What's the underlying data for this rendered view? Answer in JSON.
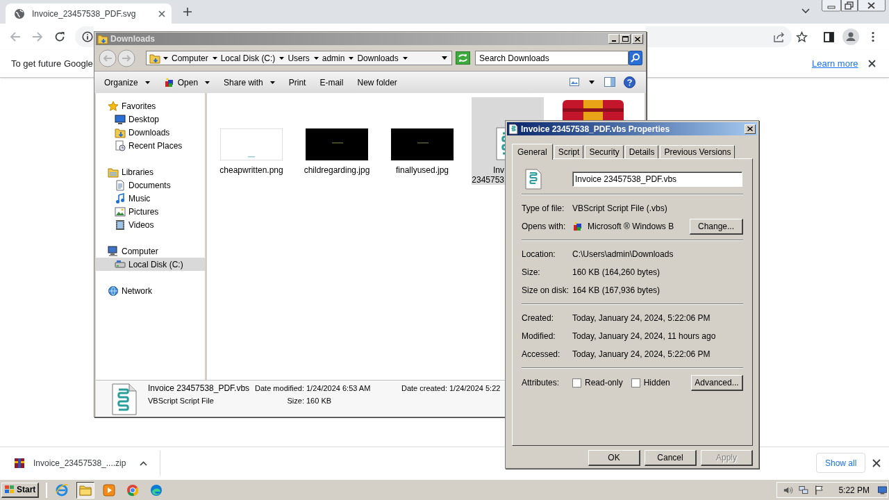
{
  "browser": {
    "tab": {
      "title": "Invoice_23457538_PDF.svg"
    },
    "infobar": {
      "message": "To get future Google",
      "link": "Learn more"
    },
    "download_shelf": {
      "filename": "Invoice_23457538_....zip",
      "show_all": "Show all"
    }
  },
  "explorer": {
    "title": "Downloads",
    "breadcrumb": [
      "Computer",
      "Local Disk (C:)",
      "Users",
      "admin",
      "Downloads"
    ],
    "search": {
      "placeholder": "Search Downloads"
    },
    "toolbar": [
      {
        "label": "Organize",
        "kind": "menu"
      },
      {
        "label": "Open",
        "kind": "app-menu"
      },
      {
        "label": "Share with",
        "kind": "menu"
      },
      {
        "label": "Print",
        "kind": "plain"
      },
      {
        "label": "E-mail",
        "kind": "plain"
      },
      {
        "label": "New folder",
        "kind": "plain"
      }
    ],
    "nav": [
      {
        "label": "Favorites",
        "kind": "star",
        "selected": false,
        "children": [
          {
            "label": "Desktop",
            "kind": "desktop",
            "selected": false
          },
          {
            "label": "Downloads",
            "kind": "downloads",
            "selected": false
          },
          {
            "label": "Recent Places",
            "kind": "recent",
            "selected": false
          }
        ]
      },
      {
        "label": "Libraries",
        "kind": "library",
        "selected": false,
        "children": [
          {
            "label": "Documents",
            "kind": "documents",
            "selected": false
          },
          {
            "label": "Music",
            "kind": "music",
            "selected": false
          },
          {
            "label": "Pictures",
            "kind": "pictures",
            "selected": false
          },
          {
            "label": "Videos",
            "kind": "videos",
            "selected": false
          }
        ]
      },
      {
        "label": "Computer",
        "kind": "computer",
        "selected": false,
        "children": [
          {
            "label": "Local Disk (C:)",
            "kind": "disk",
            "selected": true
          }
        ]
      },
      {
        "label": "Network",
        "kind": "network",
        "selected": false
      }
    ],
    "files": [
      {
        "kind": "thumb-light",
        "lines": [
          "cheapwritten.png"
        ],
        "selected": false
      },
      {
        "kind": "thumb-dark",
        "lines": [
          "childregarding.jpg"
        ],
        "selected": false
      },
      {
        "kind": "thumb-dark",
        "lines": [
          "finallyused.jpg"
        ],
        "selected": false
      },
      {
        "kind": "script",
        "lines": [
          "Inv",
          "2345753"
        ],
        "selected": true
      },
      {
        "kind": "archive",
        "selected": false
      }
    ],
    "details": {
      "name": "Invoice 23457538_PDF.vbs",
      "type": "VBScript Script File",
      "fields": [
        {
          "label": "Date modified:",
          "value": "1/24/2024 6:53 AM"
        },
        {
          "label": "Date created:",
          "value": "1/24/2024 5:22"
        },
        {
          "label": "Size:",
          "value": "160 KB"
        }
      ]
    }
  },
  "properties": {
    "title": "Invoice 23457538_PDF.vbs Properties",
    "tabs": [
      {
        "label": "General",
        "selected": true
      },
      {
        "label": "Script",
        "selected": false
      },
      {
        "label": "Security",
        "selected": false
      },
      {
        "label": "Details",
        "selected": false
      },
      {
        "label": "Previous Versions",
        "selected": false
      }
    ],
    "filename": "Invoice 23457538_PDF.vbs",
    "sections": [
      [
        {
          "kind": "text",
          "label": "Type of file:",
          "value": "VBScript Script File (.vbs)"
        },
        {
          "kind": "app",
          "label": "Opens with:",
          "value": "Microsoft ® Windows B",
          "button": "Change..."
        }
      ],
      [
        {
          "kind": "text",
          "label": "Location:",
          "value": "C:\\Users\\admin\\Downloads"
        },
        {
          "kind": "text",
          "label": "Size:",
          "value": "160 KB (164,260 bytes)"
        },
        {
          "kind": "text",
          "label": "Size on disk:",
          "value": "164 KB (167,936 bytes)"
        }
      ],
      [
        {
          "kind": "text",
          "label": "Created:",
          "value": "Today, January 24, 2024, 5:22:06 PM"
        },
        {
          "kind": "text",
          "label": "Modified:",
          "value": "Today, January 24, 2024, 11 hours ago"
        },
        {
          "kind": "text",
          "label": "Accessed:",
          "value": "Today, January 24, 2024, 5:22:06 PM"
        }
      ]
    ],
    "attributes": {
      "label": "Attributes:",
      "options": [
        {
          "label": "Read-only",
          "checked": false
        },
        {
          "label": "Hidden",
          "checked": false
        }
      ],
      "button": "Advanced..."
    },
    "buttons": [
      {
        "label": "OK",
        "disabled": false
      },
      {
        "label": "Cancel",
        "disabled": false
      },
      {
        "label": "Apply",
        "disabled": true
      }
    ]
  },
  "taskbar": {
    "start": "Start",
    "apps": [
      {
        "kind": "ie",
        "selected": false
      },
      {
        "kind": "folder",
        "selected": true
      },
      {
        "kind": "media",
        "selected": false
      },
      {
        "kind": "chrome",
        "selected": false
      },
      {
        "kind": "edge",
        "selected": false
      }
    ],
    "clock": "5:22 PM"
  }
}
